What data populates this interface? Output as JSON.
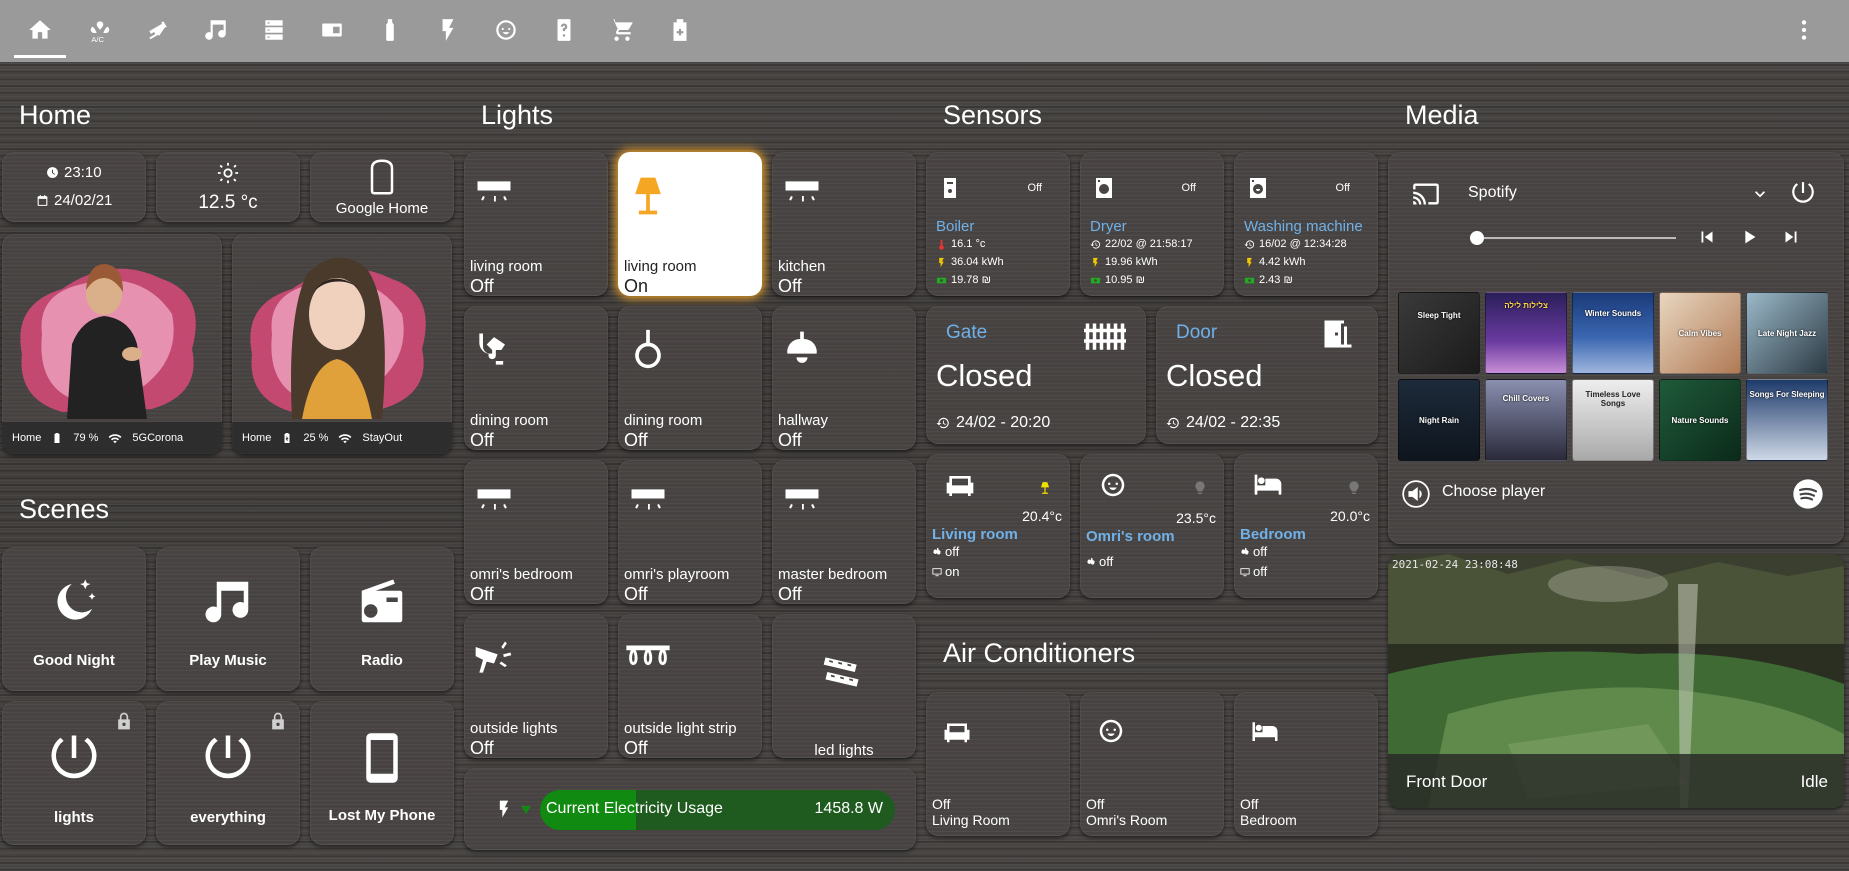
{
  "tabs": [
    {
      "icon": "home-icon"
    },
    {
      "icon": "air-conditioner-icon",
      "label": "A/C"
    },
    {
      "icon": "cctv-icon"
    },
    {
      "icon": "music-icon"
    },
    {
      "icon": "server-icon"
    },
    {
      "icon": "router-icon"
    },
    {
      "icon": "bottle-icon"
    },
    {
      "icon": "flash-icon"
    },
    {
      "icon": "baby-face-icon"
    },
    {
      "icon": "help-icon"
    },
    {
      "icon": "cart-icon"
    },
    {
      "icon": "medical-bag-icon"
    }
  ],
  "sections": {
    "home": "Home",
    "scenes": "Scenes",
    "lights": "Lights",
    "sensors": "Sensors",
    "media": "Media",
    "ac": "Air Conditioners"
  },
  "home": {
    "time": "23:10",
    "date": "24/02/21",
    "temperature": "12.5 °c",
    "google_home": "Google Home",
    "people": [
      {
        "location": "Home",
        "battery": "79 %",
        "wifi": "5GCorona"
      },
      {
        "location": "Home",
        "battery": "25 %",
        "wifi": "StayOut"
      }
    ]
  },
  "scenes": [
    {
      "label": "Good Night",
      "icon": "weather-night-icon"
    },
    {
      "label": "Play Music",
      "icon": "music-icon"
    },
    {
      "label": "Radio",
      "icon": "radio-icon"
    },
    {
      "label": "lights",
      "icon": "power-icon",
      "locked": true
    },
    {
      "label": "everything",
      "icon": "power-icon",
      "locked": true
    },
    {
      "label": "Lost My Phone",
      "icon": "cellphone-icon"
    }
  ],
  "lights": [
    {
      "name": "living room",
      "state": "Off",
      "icon": "ceiling-light-icon"
    },
    {
      "name": "living room",
      "state": "On",
      "icon": "floor-lamp-icon"
    },
    {
      "name": "kitchen",
      "state": "Off",
      "icon": "ceiling-light-icon"
    },
    {
      "name": "dining room",
      "state": "Off",
      "icon": "wall-sconce-icon"
    },
    {
      "name": "dining room",
      "state": "Off",
      "icon": "pendant-light-icon"
    },
    {
      "name": "hallway",
      "state": "Off",
      "icon": "ceiling-lamp-icon"
    },
    {
      "name": "omri's bedroom",
      "state": "Off",
      "icon": "ceiling-light-icon"
    },
    {
      "name": "omri's playroom",
      "state": "Off",
      "icon": "ceiling-light-icon"
    },
    {
      "name": "master bedroom",
      "state": "Off",
      "icon": "ceiling-light-icon"
    },
    {
      "name": "outside lights",
      "state": "Off",
      "icon": "spotlight-icon"
    },
    {
      "name": "outside light strip",
      "state": "Off",
      "icon": "string-lights-icon"
    },
    {
      "name": "led lights",
      "state": "",
      "icon": "led-strip-icon"
    }
  ],
  "electricity": {
    "label": "Current Electricity Usage",
    "value": "1458.8 W",
    "fraction": 0.27
  },
  "sensors": {
    "appliances": [
      {
        "name": "Boiler",
        "state": "Off",
        "line1": "16.1 °c",
        "line2": "36.04 kWh",
        "line3": "19.78 ₪"
      },
      {
        "name": "Dryer",
        "state": "Off",
        "line1": "22/02 @ 21:58:17",
        "line2": "19.96 kWh",
        "line3": "10.95 ₪"
      },
      {
        "name": "Washing machine",
        "state": "Off",
        "line1": "16/02 @ 12:34:28",
        "line2": "4.42 kWh",
        "line3": "2.43 ₪"
      }
    ],
    "doors": [
      {
        "name": "Gate",
        "state": "Closed",
        "time": "24/02 - 20:20"
      },
      {
        "name": "Door",
        "state": "Closed",
        "time": "24/02 - 22:35"
      }
    ],
    "rooms": [
      {
        "name": "Living room",
        "temp": "20.4°c",
        "fan": "off",
        "tv": "on"
      },
      {
        "name": "Omri's room",
        "temp": "23.5°c",
        "fan": "off",
        "tv": ""
      },
      {
        "name": "Bedroom",
        "temp": "20.0°c",
        "fan": "off",
        "tv": "off"
      }
    ]
  },
  "ac": [
    {
      "state": "Off",
      "room": "Living Room"
    },
    {
      "state": "Off",
      "room": "Omri's Room"
    },
    {
      "state": "Off",
      "room": "Bedroom"
    }
  ],
  "media": {
    "source": "Spotify",
    "choose_player": "Choose player",
    "playlists": [
      "Sleep Tight",
      "צלילות לילה",
      "Winter Sounds",
      "Calm Vibes",
      "Late Night Jazz",
      "Night Rain",
      "Chill Covers",
      "Timeless Love Songs",
      "Nature Sounds",
      "Songs For Sleeping"
    ],
    "camera": {
      "name": "Front Door",
      "state": "Idle",
      "timestamp": "2021-02-24 23:08:48"
    }
  },
  "colors": {
    "accent_on": "#f5a623",
    "link_blue": "#6fb1e8",
    "electric_green": "#118a11"
  }
}
